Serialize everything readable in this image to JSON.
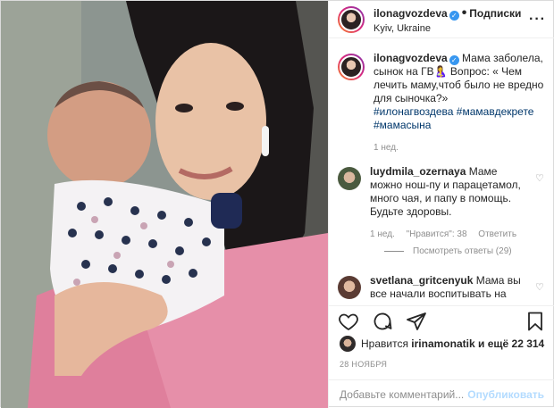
{
  "header": {
    "username": "ilonagvozdeva",
    "separator": "•",
    "follow_label": "Подписки",
    "location": "Kyiv, Ukraine",
    "more_icon": "more-icon"
  },
  "caption": {
    "username": "ilonagvozdeva",
    "text": "Мама заболела, сынок на ГВ🤱 Вопрос: « Чем лечить маму,чтоб было не вредно для сыночка?»",
    "hashtags": "#илонагвоздева #мамавдекрете #мамасына",
    "time": "1 нед."
  },
  "comments": [
    {
      "username": "luydmila_ozernaya",
      "text": "Маме можно нош-пу и парацетамол, много чая, и папу в помощь. Будьте здоровы.",
      "time": "1 нед.",
      "likes": "\"Нравится\": 38",
      "reply": "Ответить",
      "view_replies": "Посмотреть ответы (29)"
    },
    {
      "username": "svetlana_gritcenyuk",
      "text": "Мама вы все начали воспитывать на"
    }
  ],
  "actions": {
    "icons": [
      "heart-icon",
      "comment-icon",
      "share-icon",
      "bookmark-icon"
    ]
  },
  "likes": {
    "prefix": "Нравится",
    "user": "irinamonatik",
    "suffix": "и ещё 22 314"
  },
  "date": "28 НОЯБРЯ",
  "add_comment": {
    "placeholder": "Добавьте комментарий...",
    "publish": "Опубликовать"
  },
  "colors": {
    "link": "#00376b",
    "verified": "#3897f0",
    "publish_disabled": "#b3dbff",
    "muted": "#8e8e8e"
  }
}
